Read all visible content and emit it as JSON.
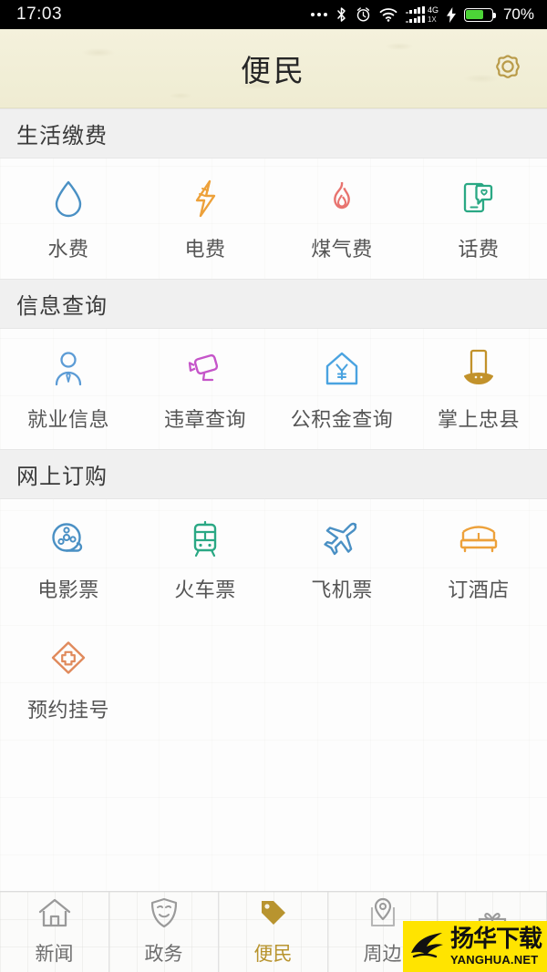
{
  "status_bar": {
    "time": "17:03",
    "battery_percent": "70%",
    "battery_level": 70,
    "network_primary": "4G",
    "network_secondary": "1X",
    "icons": [
      "more-dots-icon",
      "bluetooth-icon",
      "alarm-icon",
      "wifi-icon",
      "signal-bars-icon",
      "charging-bolt-icon",
      "battery-icon"
    ]
  },
  "header": {
    "title": "便民",
    "settings_icon": "gear-icon",
    "background_color": "#f2efd8",
    "accent_color": "#b8942f"
  },
  "sections": [
    {
      "title": "生活缴费",
      "items": [
        {
          "label": "水费",
          "icon": "water-drop-icon",
          "color": "#4a90c4"
        },
        {
          "label": "电费",
          "icon": "lightning-bolt-icon",
          "color": "#eda13a"
        },
        {
          "label": "煤气费",
          "icon": "flame-icon",
          "color": "#e8736f"
        },
        {
          "label": "话费",
          "icon": "phone-heart-icon",
          "color": "#2aa884"
        }
      ]
    },
    {
      "title": "信息查询",
      "items": [
        {
          "label": "就业信息",
          "icon": "person-tie-icon",
          "color": "#5b9bd5"
        },
        {
          "label": "违章查询",
          "icon": "surveillance-camera-icon",
          "color": "#c555c9"
        },
        {
          "label": "公积金查询",
          "icon": "house-yuan-icon",
          "color": "#4aa3e0"
        },
        {
          "label": "掌上忠县",
          "icon": "phone-in-hand-icon",
          "color": "#c2922b"
        }
      ]
    },
    {
      "title": "网上订购",
      "items": [
        {
          "label": "电影票",
          "icon": "film-reel-icon",
          "color": "#4a90c4"
        },
        {
          "label": "火车票",
          "icon": "train-icon",
          "color": "#2aa884"
        },
        {
          "label": "飞机票",
          "icon": "airplane-icon",
          "color": "#4a90c4"
        },
        {
          "label": "订酒店",
          "icon": "bed-icon",
          "color": "#eda13a"
        },
        {
          "label": "预约挂号",
          "icon": "medical-cross-diamond-icon",
          "color": "#e08a5c"
        }
      ]
    }
  ],
  "tabbar": {
    "active_index": 2,
    "active_color": "#b8942f",
    "inactive_color": "#6e6e6e",
    "items": [
      {
        "label": "新闻",
        "icon": "home-icon"
      },
      {
        "label": "政务",
        "icon": "shield-icon"
      },
      {
        "label": "便民",
        "icon": "tag-icon"
      },
      {
        "label": "周边",
        "icon": "location-pin-icon"
      },
      {
        "label": "",
        "icon": "gift-icon"
      }
    ]
  },
  "watermark": {
    "text_cn": "扬华下载",
    "text_en": "YANGHUA.NET",
    "background_color": "#ffe400"
  }
}
